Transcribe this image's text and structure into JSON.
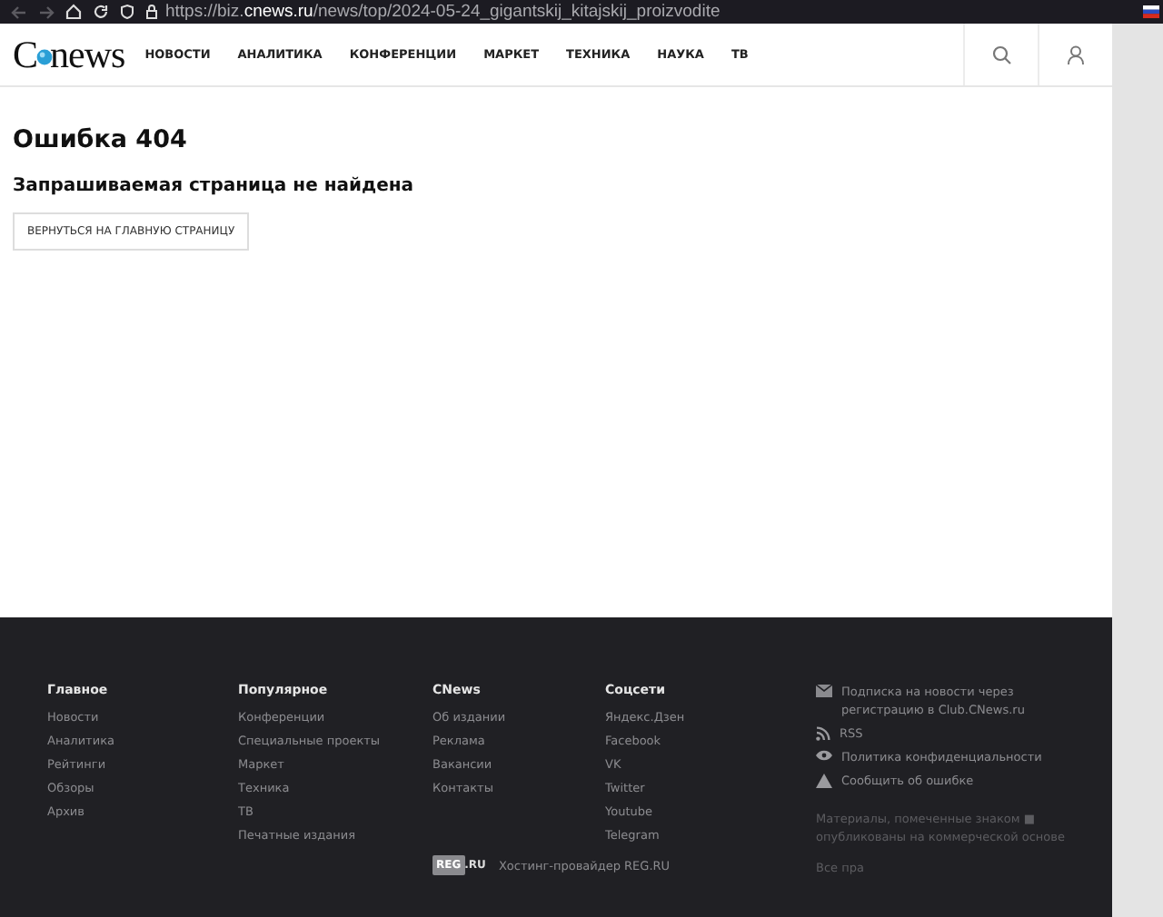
{
  "browser": {
    "url_prefix": "https://biz.",
    "url_domain": "cnews.ru",
    "url_path": "/news/top/2024-05-24_gigantskij_kitajskij_proizvodite"
  },
  "header": {
    "logo_first": "C",
    "logo_rest": "news",
    "nav": [
      "НОВОСТИ",
      "АНАЛИТИКА",
      "КОНФЕРЕНЦИИ",
      "МАРКЕТ",
      "ТЕХНИКА",
      "НАУКА",
      "ТВ"
    ]
  },
  "error": {
    "title": "Ошибка 404",
    "subtitle": "Запрашиваемая страница не найдена",
    "button": "ВЕРНУТЬСЯ НА ГЛАВНУЮ СТРАНИЦУ"
  },
  "footer": {
    "columns": [
      {
        "title": "Главное",
        "links": [
          "Новости",
          "Аналитика",
          "Рейтинги",
          "Обзоры",
          "Архив"
        ]
      },
      {
        "title": "Популярное",
        "links": [
          "Конференции",
          "Специальные проекты",
          "Маркет",
          "Техника",
          "ТВ",
          "Печатные издания"
        ]
      },
      {
        "title": "CNews",
        "links": [
          "Об издании",
          "Реклама",
          "Вакансии",
          "Контакты"
        ]
      },
      {
        "title": "Соцсети",
        "links": [
          "Яндекс.Дзен",
          "Facebook",
          "VK",
          "Twitter",
          "Youtube",
          "Telegram"
        ]
      }
    ],
    "info": [
      {
        "kind": "mail",
        "text": "Подписка на новости через регистрацию в Club.CNews.ru"
      },
      {
        "kind": "rss",
        "text": "RSS"
      },
      {
        "kind": "eye",
        "text": "Политика конфиденциальности"
      },
      {
        "kind": "warning",
        "text": "Сообщить об ошибке"
      }
    ],
    "note": "Материалы, помеченные знаком ■ опубликованы на коммерческой основе",
    "rights": "Все пра",
    "hosting_logo_a": "REG",
    "hosting_logo_b": ".RU",
    "hosting": "Хостинг-провайдер REG.RU"
  }
}
